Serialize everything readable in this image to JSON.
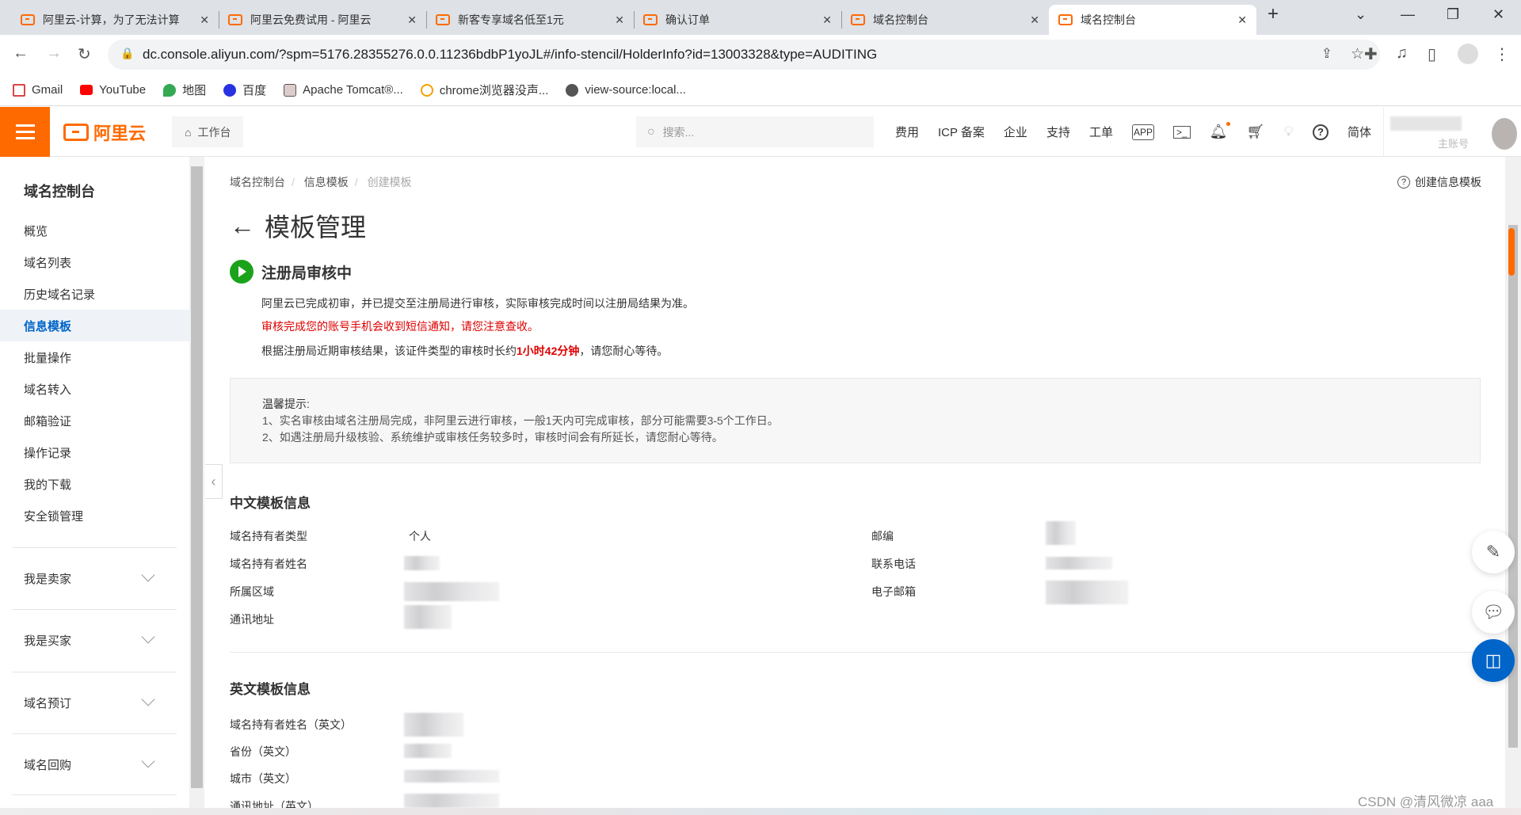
{
  "browser": {
    "tabs": [
      {
        "title": "阿里云-计算，为了无法计算"
      },
      {
        "title": "阿里云免费试用 - 阿里云"
      },
      {
        "title": "新客专享域名低至1元"
      },
      {
        "title": "确认订单"
      },
      {
        "title": "域名控制台"
      },
      {
        "title": "域名控制台",
        "active": true
      }
    ],
    "url": "dc.console.aliyun.com/?spm=5176.28355276.0.0.11236bdbP1yoJL#/info-stencil/HolderInfo?id=13003328&type=AUDITING",
    "bookmarks": [
      {
        "label": "Gmail",
        "icon": "gmail-icon"
      },
      {
        "label": "YouTube",
        "icon": "youtube-icon"
      },
      {
        "label": "地图",
        "icon": "maps-icon"
      },
      {
        "label": "百度",
        "icon": "baidu-icon"
      },
      {
        "label": "Apache Tomcat®...",
        "icon": "tomcat-icon"
      },
      {
        "label": "chrome浏览器没声...",
        "icon": "site-icon"
      },
      {
        "label": "view-source:local...",
        "icon": "globe-icon"
      }
    ]
  },
  "header": {
    "logo": "阿里云",
    "workbench": "工作台",
    "search_placeholder": "搜索...",
    "nav": [
      "费用",
      "ICP 备案",
      "企业",
      "支持",
      "工单"
    ],
    "lang": "简体",
    "account_partial": "主账号",
    "accent": "#ff6a00"
  },
  "sidebar": {
    "title": "域名控制台",
    "items": [
      {
        "label": "概览"
      },
      {
        "label": "域名列表"
      },
      {
        "label": "历史域名记录"
      },
      {
        "label": "信息模板",
        "active": true
      },
      {
        "label": "批量操作"
      },
      {
        "label": "域名转入"
      },
      {
        "label": "邮箱验证"
      },
      {
        "label": "操作记录"
      },
      {
        "label": "我的下载"
      },
      {
        "label": "安全锁管理"
      }
    ],
    "groups": [
      "我是卖家",
      "我是买家",
      "域名预订",
      "域名回购"
    ]
  },
  "main": {
    "breadcrumb": [
      "域名控制台",
      "信息模板",
      "创建模板"
    ],
    "help_link": "创建信息模板",
    "title": "模板管理",
    "status": "注册局审核中",
    "line1": "阿里云已完成初审，并已提交至注册局进行审核，实际审核完成时间以注册局结果为准。",
    "line2": "审核完成您的账号手机会收到短信通知，请您注意查收。",
    "line3_pre": "根据注册局近期审核结果，该证件类型的审核时长约",
    "line3_em": "1小时42分钟",
    "line3_post": "，请您耐心等待。",
    "tip": {
      "heading": "温馨提示:",
      "lines": [
        "1、实名审核由域名注册局完成，非阿里云进行审核，一般1天内可完成审核，部分可能需要3-5个工作日。",
        "2、如遇注册局升级核验、系统维护或审核任务较多时，审核时间会有所延长，请您耐心等待。"
      ]
    },
    "cn_section": {
      "title": "中文模板信息",
      "left": [
        {
          "label": "域名持有者类型",
          "value": "个人"
        },
        {
          "label": "域名持有者姓名"
        },
        {
          "label": "所属区域"
        },
        {
          "label": "通讯地址"
        }
      ],
      "right": [
        {
          "label": "邮编"
        },
        {
          "label": "联系电话"
        },
        {
          "label": "电子邮箱"
        }
      ]
    },
    "en_section": {
      "title": "英文模板信息",
      "left": [
        {
          "label": "域名持有者姓名（英文）"
        },
        {
          "label": "省份（英文）"
        },
        {
          "label": "城市（英文）"
        },
        {
          "label": "通讯地址（英文）"
        }
      ]
    }
  },
  "watermark": "CSDN @清风微凉 aaa"
}
